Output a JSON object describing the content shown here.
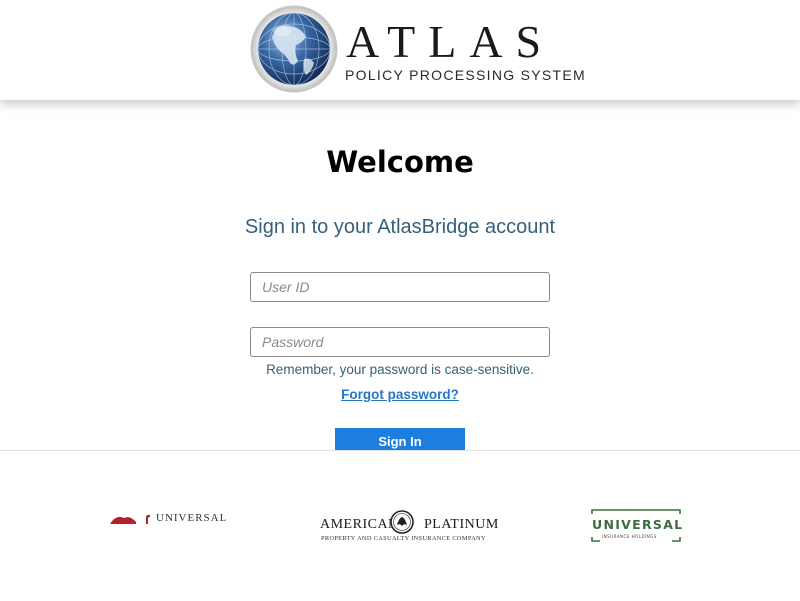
{
  "header": {
    "brand_title": "ATLAS",
    "brand_subtitle": "POLICY PROCESSING SYSTEM",
    "logo_icon": "globe-icon"
  },
  "login": {
    "welcome": "Welcome",
    "subtitle": "Sign in to your AtlasBridge account",
    "userid_placeholder": "User ID",
    "userid_value": "",
    "password_placeholder": "Password",
    "password_value": "",
    "reminder": "Remember, your password is case-sensitive.",
    "forgot_label": "Forgot password?",
    "signin_label": "Sign In"
  },
  "partners": {
    "universal_red": {
      "name": "UNIVERSAL"
    },
    "american_platinum": {
      "name_left": "AMERICAN",
      "name_right": "PLATINUM",
      "tagline": "PROPERTY AND CASUALTY INSURANCE COMPANY"
    },
    "universal_green": {
      "name": "UNIVERSAL",
      "tagline": "INSURANCE HOLDINGS"
    }
  },
  "colors": {
    "accent_button": "#1e7ee0",
    "subtitle_text": "#35607a",
    "link": "#2577c8",
    "universal_red": "#b3232a",
    "universal_green": "#3b6e3f"
  }
}
